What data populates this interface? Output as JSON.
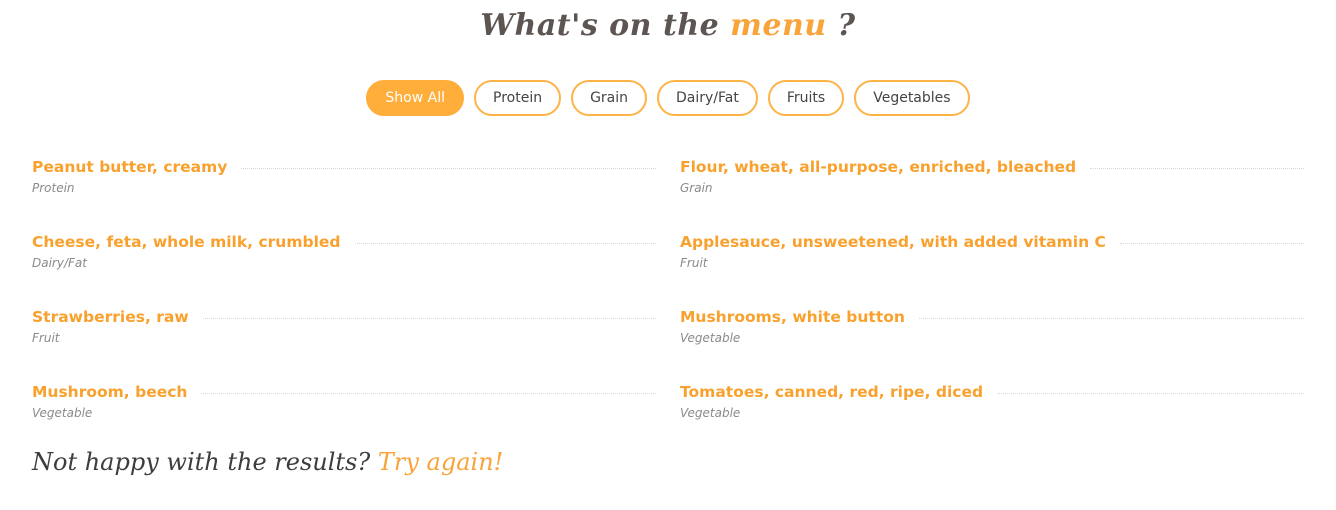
{
  "heading": {
    "prefix": "What's on the ",
    "accent": "menu",
    "suffix": " ?"
  },
  "filters": [
    {
      "label": "Show All",
      "active": true
    },
    {
      "label": "Protein",
      "active": false
    },
    {
      "label": "Grain",
      "active": false
    },
    {
      "label": "Dairy/Fat",
      "active": false
    },
    {
      "label": "Fruits",
      "active": false
    },
    {
      "label": "Vegetables",
      "active": false
    }
  ],
  "menu_items": [
    {
      "name": "Peanut butter, creamy",
      "category": "Protein"
    },
    {
      "name": "Flour, wheat, all-purpose, enriched, bleached",
      "category": "Grain"
    },
    {
      "name": "Cheese, feta, whole milk, crumbled",
      "category": "Dairy/Fat"
    },
    {
      "name": "Applesauce, unsweetened, with added vitamin C",
      "category": "Fruit"
    },
    {
      "name": "Strawberries, raw",
      "category": "Fruit"
    },
    {
      "name": "Mushrooms, white button",
      "category": "Vegetable"
    },
    {
      "name": "Mushroom, beech",
      "category": "Vegetable"
    },
    {
      "name": "Tomatoes, canned, red, ripe, diced",
      "category": "Vegetable"
    }
  ],
  "footer": {
    "question": "Not happy with the results? ",
    "link": "Try again!"
  },
  "colors": {
    "accent": "#f9a43a",
    "button_active_bg": "#ffae3b",
    "button_border": "#ffb347",
    "item_name": "#f9a12e",
    "heading_text": "#5c5552"
  }
}
